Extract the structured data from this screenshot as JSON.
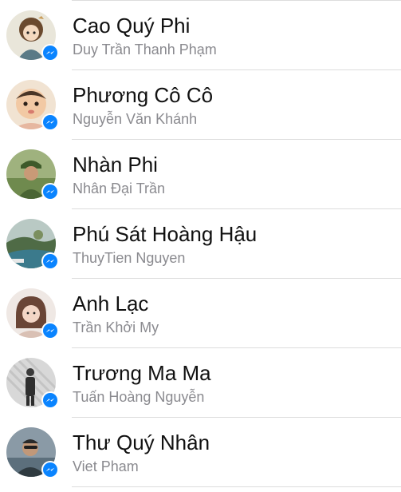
{
  "colors": {
    "name_text": "#111111",
    "secondary_text": "#8a8a8f",
    "messenger_badge": "#0a84ff",
    "divider": "#dcdcdc"
  },
  "contacts": [
    {
      "name": "Cao Quý Phi",
      "subtitle": "Duy Trần Thanh Phạm",
      "badge_icon": "messenger-icon"
    },
    {
      "name": "Phương Cô Cô",
      "subtitle": "Nguyễn Văn Khánh",
      "badge_icon": "messenger-icon"
    },
    {
      "name": "Nhàn Phi",
      "subtitle": "Nhân Đại Trần",
      "badge_icon": "messenger-icon"
    },
    {
      "name": "Phú Sát Hoàng Hậu",
      "subtitle": "ThuyTien Nguyen",
      "badge_icon": "messenger-icon"
    },
    {
      "name": "Anh Lạc",
      "subtitle": "Trần Khởi My",
      "badge_icon": "messenger-icon"
    },
    {
      "name": "Trương Ma Ma",
      "subtitle": "Tuấn Hoàng Nguyễn",
      "badge_icon": "messenger-icon"
    },
    {
      "name": "Thư Quý Nhân",
      "subtitle": "Viet Pham",
      "badge_icon": "messenger-icon"
    }
  ]
}
